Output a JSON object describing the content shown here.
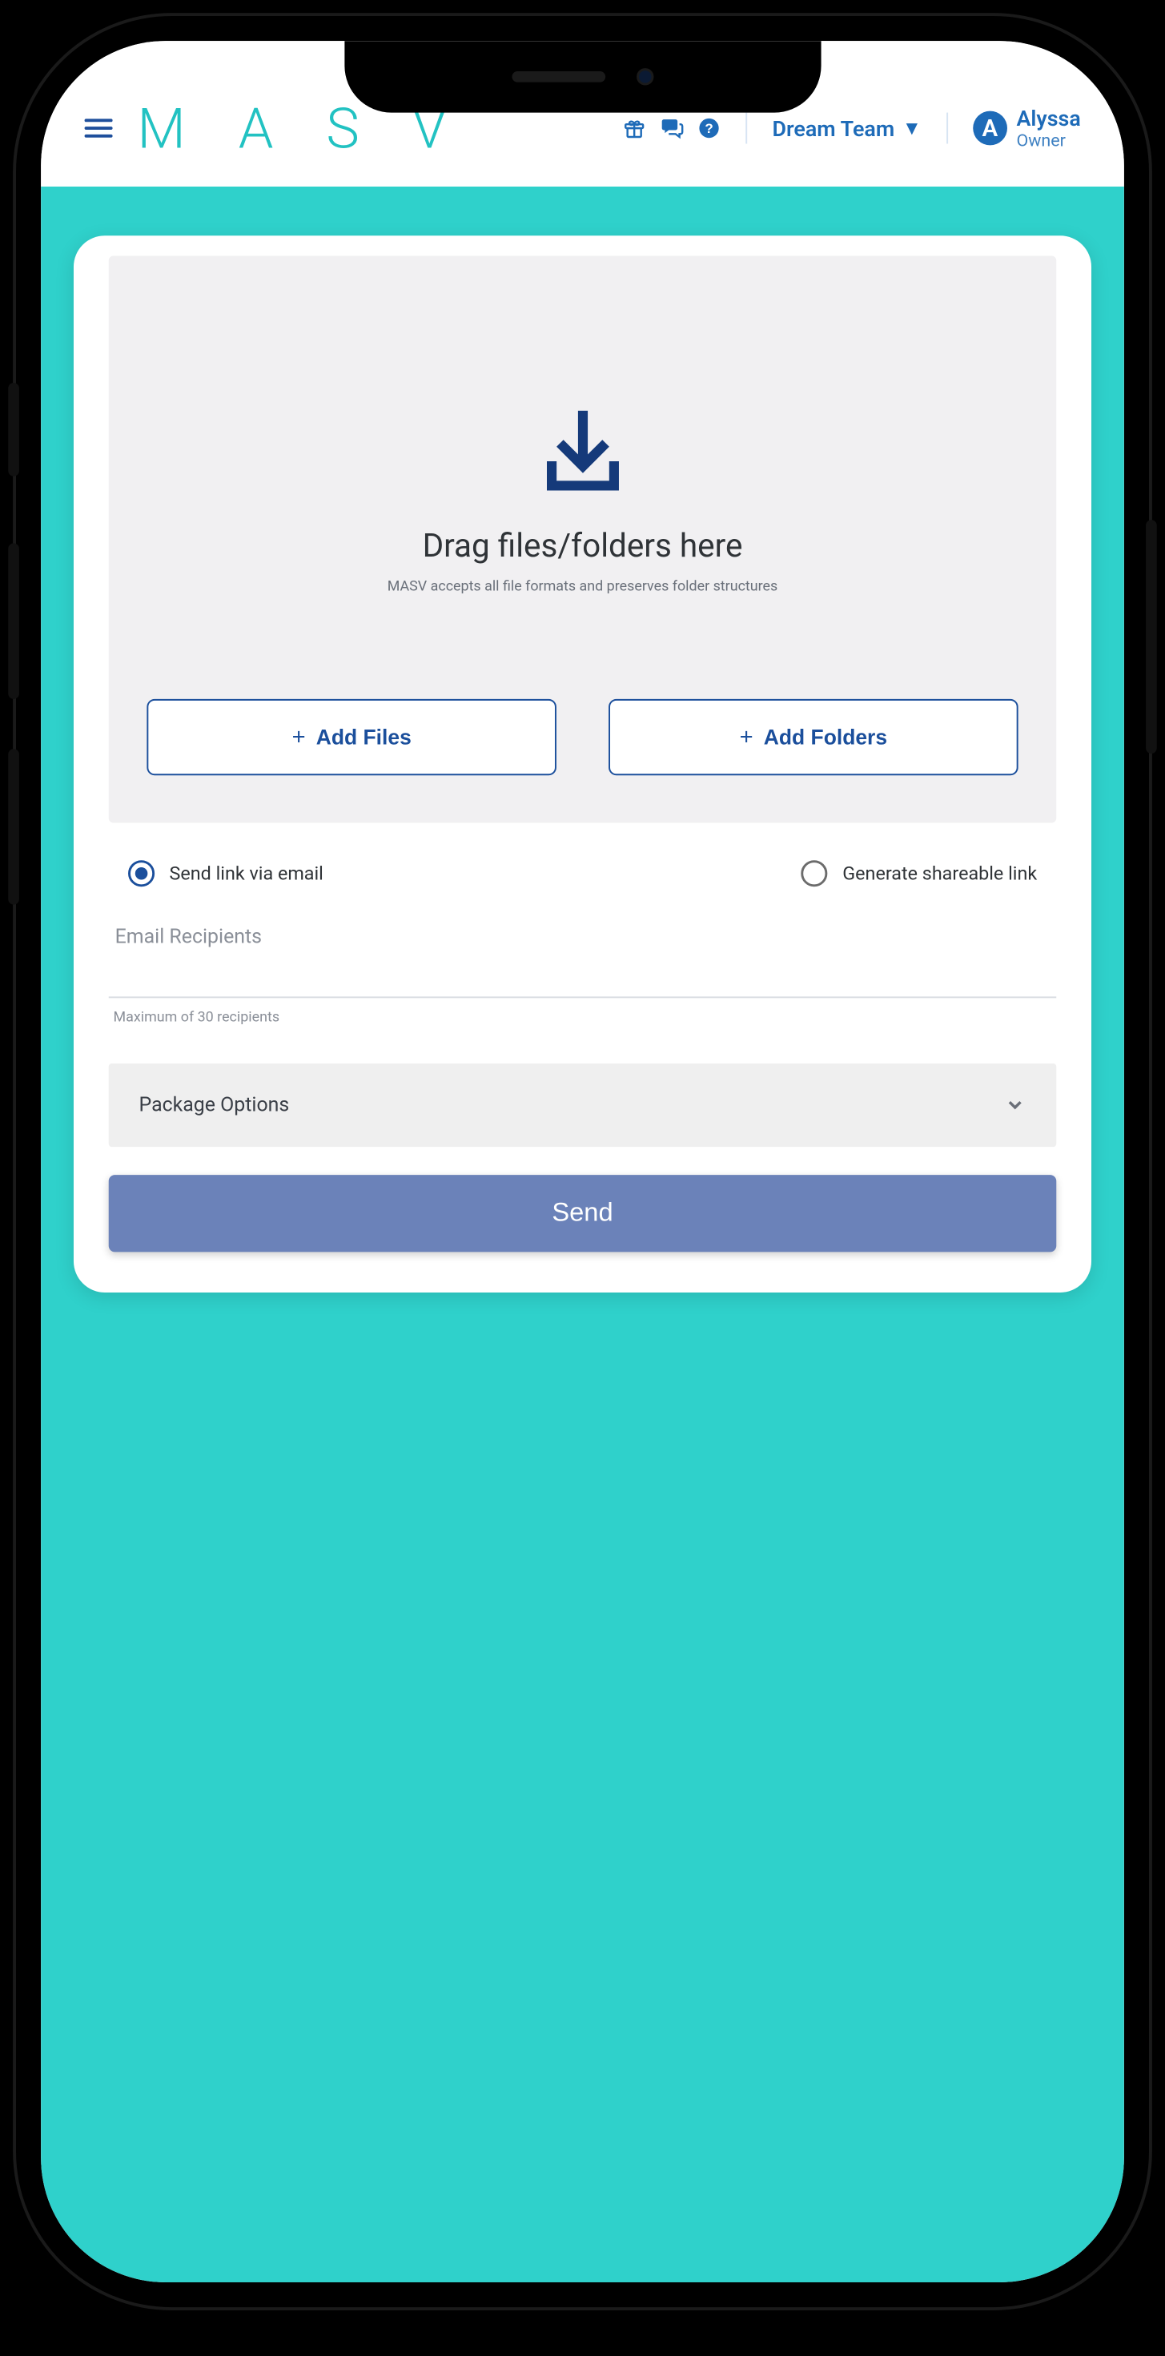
{
  "header": {
    "logo_text": "M A S V",
    "team_label": "Dream Team",
    "user": {
      "initial": "A",
      "name": "Alyssa",
      "role": "Owner"
    }
  },
  "dropzone": {
    "title": "Drag files/folders here",
    "subtitle": "MASV accepts all file formats and preserves folder structures",
    "add_files_label": "Add Files",
    "add_folders_label": "Add Folders"
  },
  "delivery": {
    "email_option": "Send link via email",
    "link_option": "Generate shareable link",
    "selected": "email"
  },
  "email": {
    "label": "Email Recipients",
    "value": "",
    "hint": "Maximum of 30 recipients"
  },
  "package_options_label": "Package Options",
  "send_label": "Send",
  "icons": {
    "menu": "menu-icon",
    "gift": "gift-icon",
    "chat": "chat-icon",
    "help": "help-icon",
    "dropdown": "caret-down-icon",
    "download": "download-tray-icon",
    "chevron": "chevron-down-icon"
  }
}
